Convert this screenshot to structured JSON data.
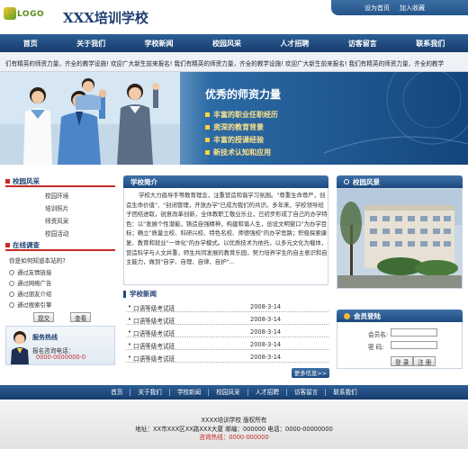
{
  "header": {
    "logo_text": "LOGO",
    "site_title": "XXX培训学校",
    "top_links": [
      "设为首页",
      "加入收藏"
    ]
  },
  "nav": [
    "首页",
    "关于我们",
    "学校新闻",
    "校园风采",
    "人才招聘",
    "访客留言",
    "联系我们"
  ],
  "marquee": "们有精英的师资力量，齐全的教学设施! 欢迎广大新生前来报名! 我们有精英的师资力量，齐全的教学设施! 欢迎广大新生前来报名! 我们有精英的师资力量，齐全的教学",
  "banner": {
    "title": "优秀的师资力量",
    "items": [
      "丰富的职业任职经历",
      "资深的教育背景",
      "丰富的授课经验",
      "新技术认知和应用"
    ]
  },
  "sidebar": {
    "campus_title": "校园风采",
    "campus_links": [
      "校园环境",
      "培训照片",
      "师资风采",
      "校园活动"
    ],
    "survey_title": "在线调查",
    "survey_question": "你是如何知道本站的?",
    "survey_options": [
      "通过友情链接",
      "通过网络广告",
      "通过朋友介绍",
      "通过搜索引擎"
    ],
    "submit_label": "提交",
    "view_label": "查看",
    "hotline_title": "服务热线",
    "hotline_label": "报名咨询电话：",
    "hotline_number": "0000-0000000-0"
  },
  "intro": {
    "title": "学校简介",
    "text": "学校大力倡导手等教育理念，注重营造和谐学习氛围。\"尊重生命尊严，创造生命价值\"、\"封闭管理，开放办学\"已成为我们的共识。多年来，学校领导班子团结进取，锐意改革创新，全体教职工敬业乐业，已初步形成了自己的办学特色：以\"发展个性潜能，铸造自强精神，构建和谐人生，创设文明窗口\"为办学目标；确立\"质量立校、科研兴校、特色名校、师德强校\"的办学思路；积极探索康复、教育和就业\"一体化\"的办学模式。以优质技术为依托，以多元文化为载体，营造科学与人文并重，师生共同发展的教育乐园，努力培养学生的自主意识和自主能力，做到\"自学、自理、自律、自护\"..."
  },
  "news": {
    "title": "学校新闻",
    "items": [
      {
        "title": "口语等级考试班",
        "date": "2008-3-14"
      },
      {
        "title": "口语等级考试班",
        "date": "2008-3-14"
      },
      {
        "title": "口语等级考试班",
        "date": "2008-3-14"
      },
      {
        "title": "口语等级考试班",
        "date": "2008-3-14"
      },
      {
        "title": "口语等级考试班",
        "date": "2008-3-14"
      }
    ],
    "more_label": "更多信息>>"
  },
  "campus_view": {
    "title": "校园风景"
  },
  "login": {
    "title": "会员登陆",
    "username_label": "会员名:",
    "password_label": "密  码:",
    "login_label": "登 录",
    "register_label": "注 册"
  },
  "footer": {
    "links": [
      "首页",
      "关于我们",
      "学校新闻",
      "校园风采",
      "人才招聘",
      "访客留言",
      "联系我们"
    ],
    "copyright": "XXXX培训学校   版权所有",
    "address": "地址：XX市XXX区XX路XXX大厦   邮编：000000   电话：0000-00000000",
    "hotline": "咨询热线：0000-000000"
  },
  "colors": {
    "primary": "#1d4a80",
    "accent": "#c62a2a",
    "banner_text": "#ffe38a"
  }
}
